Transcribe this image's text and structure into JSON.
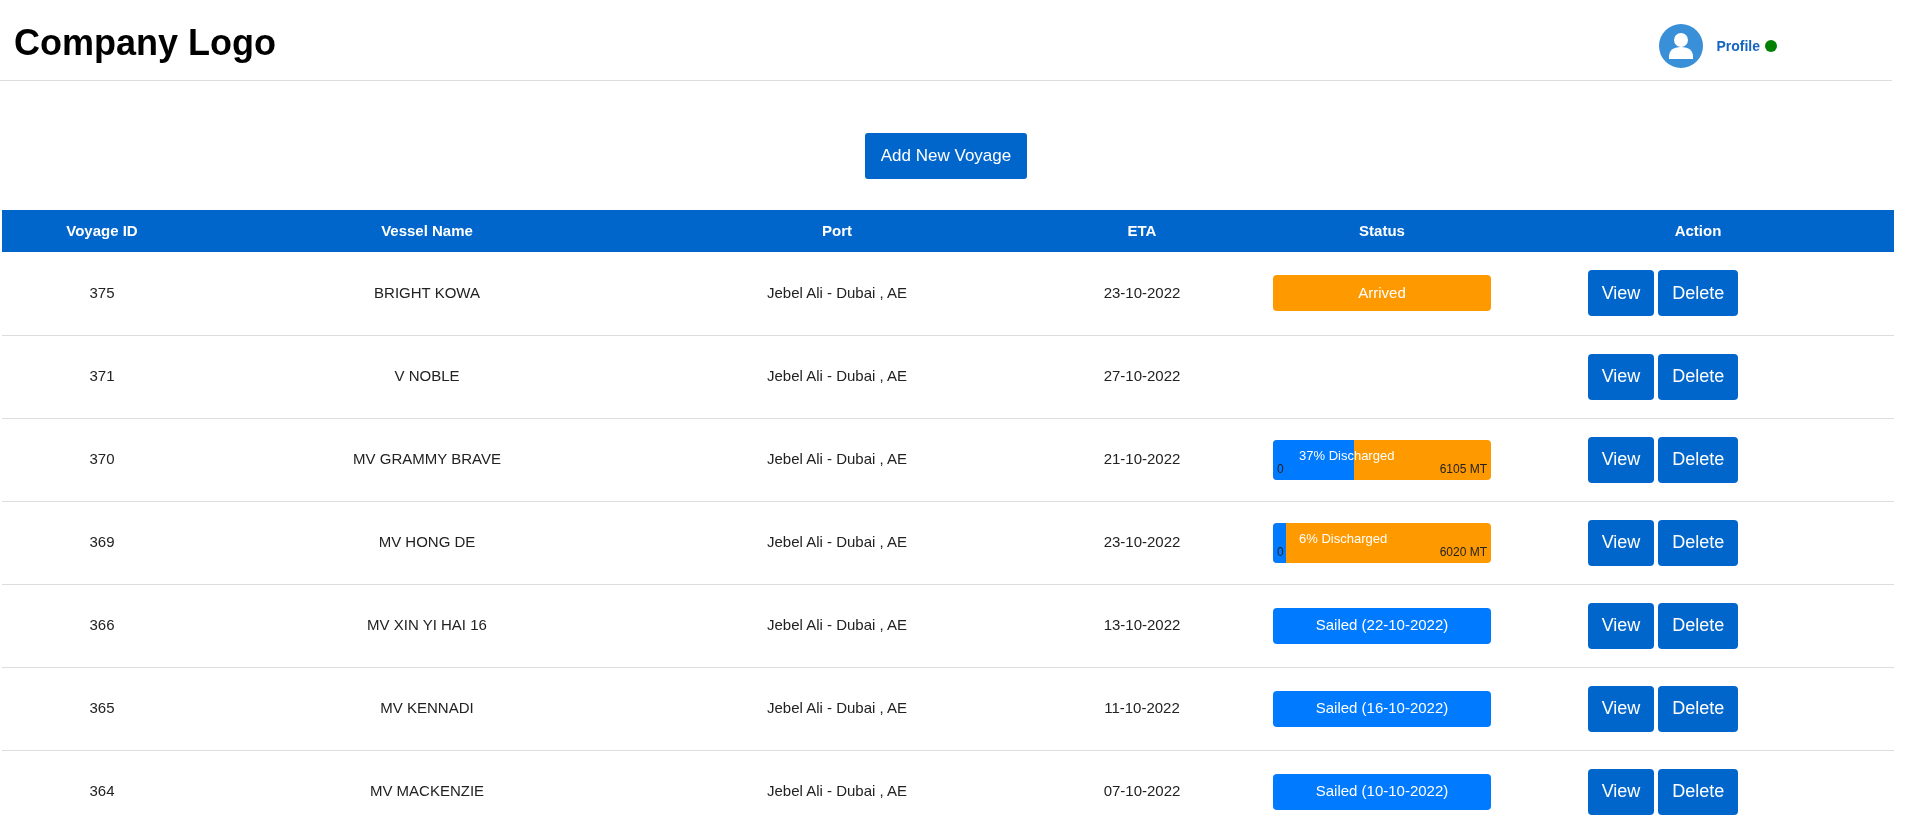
{
  "header": {
    "logo": "Company Logo",
    "profile": {
      "label": "Profile",
      "online": true
    }
  },
  "add_button": "Add New Voyage",
  "table": {
    "columns": [
      "Voyage ID",
      "Vessel Name",
      "Port",
      "ETA",
      "Status",
      "Action"
    ],
    "rows": [
      {
        "id": "375",
        "vessel": "BRIGHT KOWA",
        "port": "Jebel Ali - Dubai , AE",
        "eta": "23-10-2022",
        "status": {
          "kind": "badge",
          "text": "Arrived",
          "color": "#ff9900"
        },
        "actions": [
          "View",
          "Delete"
        ]
      },
      {
        "id": "371",
        "vessel": "V NOBLE",
        "port": "Jebel Ali - Dubai , AE",
        "eta": "27-10-2022",
        "actions": [
          "View",
          "Delete"
        ]
      },
      {
        "id": "370",
        "vessel": "MV GRAMMY BRAVE",
        "port": "Jebel Ali - Dubai , AE",
        "eta": "21-10-2022",
        "status": {
          "kind": "progress",
          "text": "37% Discharged",
          "level": 0.37,
          "start": "0",
          "end": "6105 MT"
        },
        "actions": [
          "View",
          "Delete"
        ]
      },
      {
        "id": "369",
        "vessel": "MV HONG DE",
        "port": "Jebel Ali - Dubai , AE",
        "eta": "23-10-2022",
        "status": {
          "kind": "progress",
          "text": "6% Discharged",
          "level": 0.06,
          "start": "0",
          "end": "6020 MT"
        },
        "actions": [
          "View",
          "Delete"
        ]
      },
      {
        "id": "366",
        "vessel": "MV XIN YI HAI 16",
        "port": "Jebel Ali - Dubai , AE",
        "eta": "13-10-2022",
        "status": {
          "kind": "badge",
          "text": "Sailed (22-10-2022)",
          "color": "#007bff"
        },
        "actions": [
          "View",
          "Delete"
        ]
      },
      {
        "id": "365",
        "vessel": "MV KENNADI",
        "port": "Jebel Ali - Dubai , AE",
        "eta": "11-10-2022",
        "status": {
          "kind": "badge",
          "text": "Sailed (16-10-2022)",
          "color": "#007bff"
        },
        "actions": [
          "View",
          "Delete"
        ]
      },
      {
        "id": "364",
        "vessel": "MV MACKENZIE",
        "port": "Jebel Ali - Dubai , AE",
        "eta": "07-10-2022",
        "status": {
          "kind": "badge",
          "text": "Sailed (10-10-2022)",
          "color": "#007bff"
        },
        "actions": [
          "View",
          "Delete"
        ]
      }
    ]
  }
}
